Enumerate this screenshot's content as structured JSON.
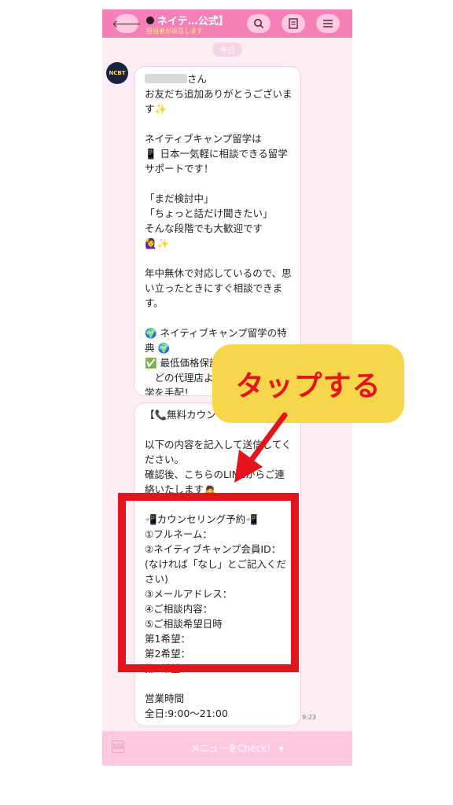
{
  "header": {
    "title": "ネイテ…公式】",
    "subtitle": "担当者が返信します",
    "back_icon": "arrow-left-icon",
    "search_icon": "search-icon",
    "notes_icon": "notes-icon",
    "menu_icon": "hamburger-icon"
  },
  "date_label": "今日",
  "avatar_label": "NCBT",
  "messages": {
    "first": {
      "suffix": "さん",
      "body": "お友だち追加ありがとうございます✨\n\nネイティブキャンプ留学は\n📱 日本一気軽に相談できる留学サポートです！\n\n「まだ検討中」\n「ちょっと話だけ聞きたい」\nそんな段階でも大歓迎です\n🙋‍♀️✨\n\n年中無休で対応しているので、思い立ったときにすぐ相談できます。\n\n🌍 ネイティブキャンプ留学の特典 🌍\n✅ 最低価格保証\n　どの代理店よりも安く留\n学を手配！"
    },
    "second": {
      "body": "【📞無料カウンセリング\n\n以下の内容を記入して送信してください。\n確認後、こちらのLINEからご連絡いたします🙇\n\n📲カウンセリング予約📲\n①フルネーム：\n②ネイティブキャンプ会員ID：(なければ「なし」とご記入ください)\n③メールアドレス：\n④ご相談内容：\n⑤ご相談希望日時\n第1希望：\n第2希望：\n第3希望：\n\n営業時間\n全日:9:00～21:00\n================",
      "time": "9:23"
    }
  },
  "bottom_bar": {
    "keyboard_icon": "keyboard-icon",
    "menu_label": "メニューをCheck！ ▾"
  },
  "annotation": {
    "callout_text": "タップする",
    "callout_color": "#f8d64c",
    "highlight_color": "#e3141b"
  },
  "colors": {
    "header_bg": "#f580b5",
    "chat_bg": "#fdeef6",
    "bottom_bg": "#ffc9e0"
  }
}
